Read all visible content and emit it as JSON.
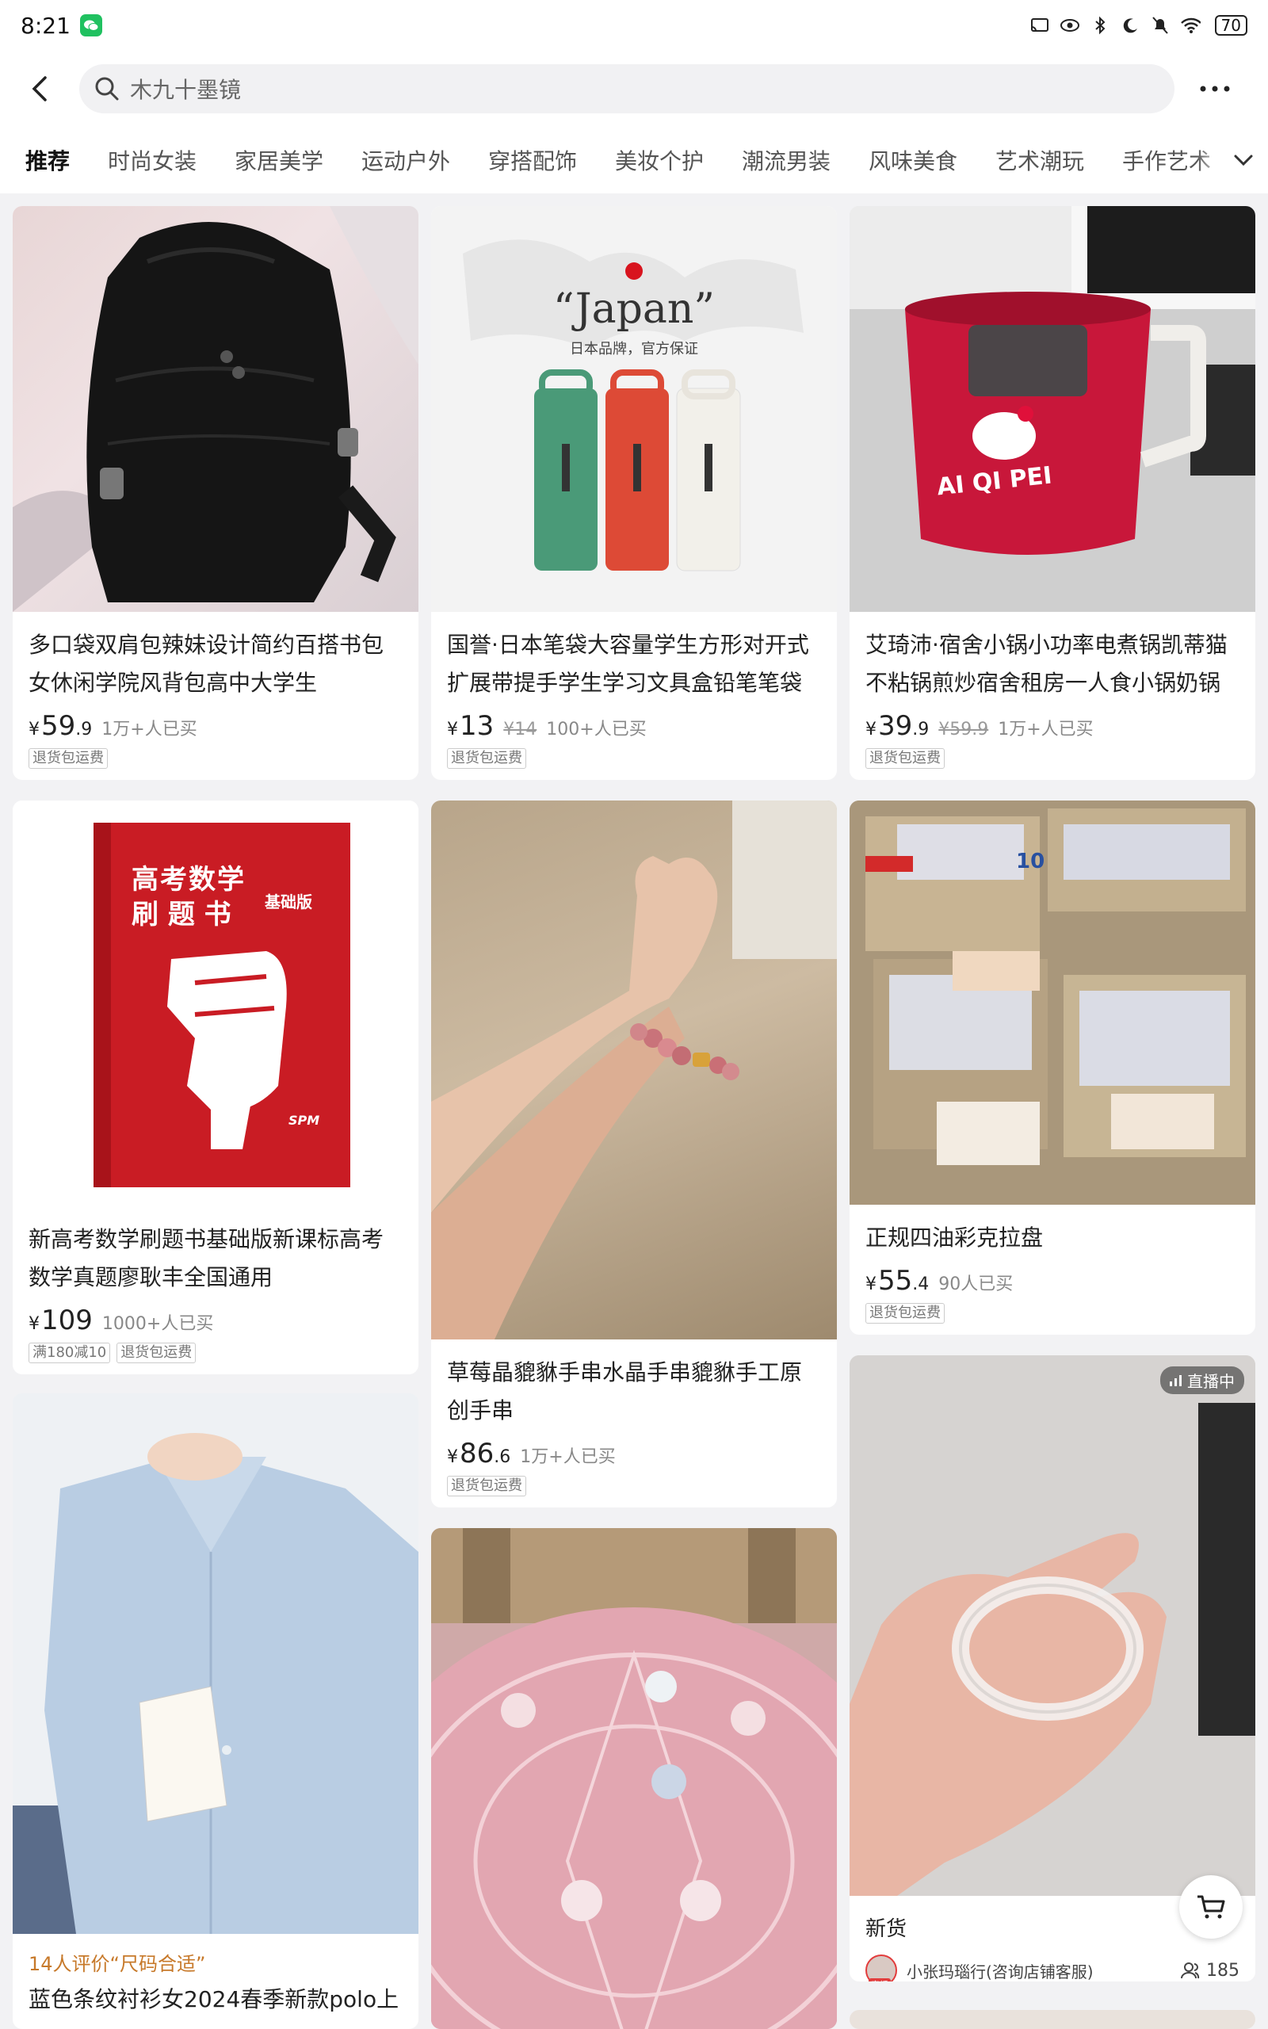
{
  "status_bar": {
    "time": "8:21",
    "battery": "70"
  },
  "search": {
    "placeholder": "木九十墨镜"
  },
  "tabs": [
    {
      "label": "推荐"
    },
    {
      "label": "时尚女装"
    },
    {
      "label": "家居美学"
    },
    {
      "label": "运动户外"
    },
    {
      "label": "穿搭配饰"
    },
    {
      "label": "美妆个护"
    },
    {
      "label": "潮流男装"
    },
    {
      "label": "风味美食"
    },
    {
      "label": "艺术潮玩"
    },
    {
      "label": "手作艺术"
    }
  ],
  "products": [
    {
      "title": "多口袋双肩包辣妹设计简约百搭书包女休闲学院风背包高中大学生",
      "currency": "¥",
      "price_int": "59",
      "price_dec": ".9",
      "sold": "1万+人已买",
      "tags": [
        "退货包运费"
      ]
    },
    {
      "image_text_brand": "“Japan”",
      "image_text_sub": "日本品牌，官方保证",
      "title": "国誉·日本笔袋大容量学生方形对开式扩展带提手学生学习文具盒铅笔笔袋",
      "currency": "¥",
      "price_int": "13",
      "orig_price": "¥14",
      "sold": "100+人已买",
      "tags": [
        "退货包运费"
      ]
    },
    {
      "image_text_brand": "AI QI PEI",
      "title": "艾琦沛·宿舍小锅小功率电煮锅凯蒂猫不粘锅煎炒宿舍租房一人食小锅奶锅",
      "currency": "¥",
      "price_int": "39",
      "price_dec": ".9",
      "orig_price": "¥59.9",
      "sold": "1万+人已买",
      "tags": [
        "退货包运费"
      ]
    },
    {
      "image_text_title1": "高考数学",
      "image_text_title2": "刷 题 书",
      "image_text_sub": "基础版",
      "image_text_brand": "SPM",
      "title": "新高考数学刷题书基础版新课标高考数学真题廖耿丰全国通用",
      "currency": "¥",
      "price_int": "109",
      "sold": "1000+人已买",
      "tags": [
        "满180减10",
        "退货包运费"
      ]
    },
    {
      "title": "草莓晶貔貅手串水晶手串貔貅手工原创手串",
      "currency": "¥",
      "price_int": "86",
      "price_dec": ".6",
      "sold": "1万+人已买",
      "tags": [
        "退货包运费"
      ]
    },
    {
      "image_text_number": "10",
      "title": "正规四油彩克拉盘",
      "currency": "¥",
      "price_int": "55",
      "price_dec": ".4",
      "sold": "90人已买",
      "tags": [
        "退货包运费"
      ]
    },
    {
      "review": "14人评价“尺码合适”",
      "title": "蓝色条纹衬衫女2024春季新款polo上"
    },
    {
      "live": "直播中",
      "title": "新货",
      "shop_name": "小张玛瑙行(咨询店铺客服)",
      "live_label": "直播",
      "viewers": "185"
    }
  ]
}
